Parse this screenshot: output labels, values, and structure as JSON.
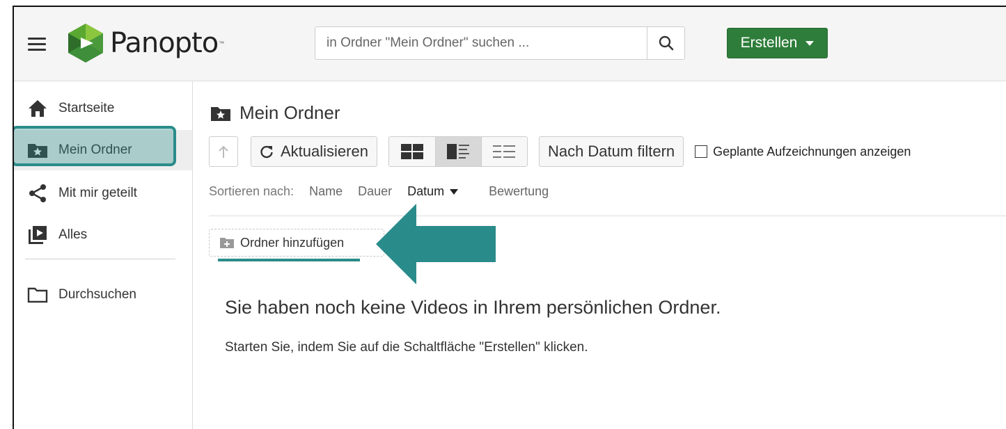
{
  "header": {
    "brand": "Panopto",
    "brand_tm": "™",
    "search_placeholder": "in Ordner \"Mein Ordner\" suchen ...",
    "create_label": "Erstellen"
  },
  "sidebar": {
    "items": [
      {
        "label": "Startseite",
        "icon": "home-icon"
      },
      {
        "label": "Mein Ordner",
        "icon": "star-folder-icon"
      },
      {
        "label": "Mit mir geteilt",
        "icon": "share-icon"
      },
      {
        "label": "Alles",
        "icon": "video-library-icon"
      },
      {
        "label": "Durchsuchen",
        "icon": "folder-icon"
      }
    ]
  },
  "main": {
    "title": "Mein Ordner",
    "toolbar": {
      "refresh_label": "Aktualisieren",
      "date_filter_label": "Nach Datum filtern",
      "scheduled_label": "Geplante Aufzeichnungen anzeigen"
    },
    "sort": {
      "label": "Sortieren nach:",
      "options": [
        "Name",
        "Dauer",
        "Datum",
        "Bewertung"
      ],
      "active": "Datum"
    },
    "add_folder_label": "Ordner hinzufügen",
    "empty_title": "Sie haben noch keine Videos in Ihrem persönlichen Ordner.",
    "empty_sub": "Starten Sie, indem Sie auf die Schaltfläche \"Erstellen\" klicken."
  },
  "colors": {
    "accent_teal": "#2a8c8a",
    "create_green": "#2e7d3a"
  }
}
